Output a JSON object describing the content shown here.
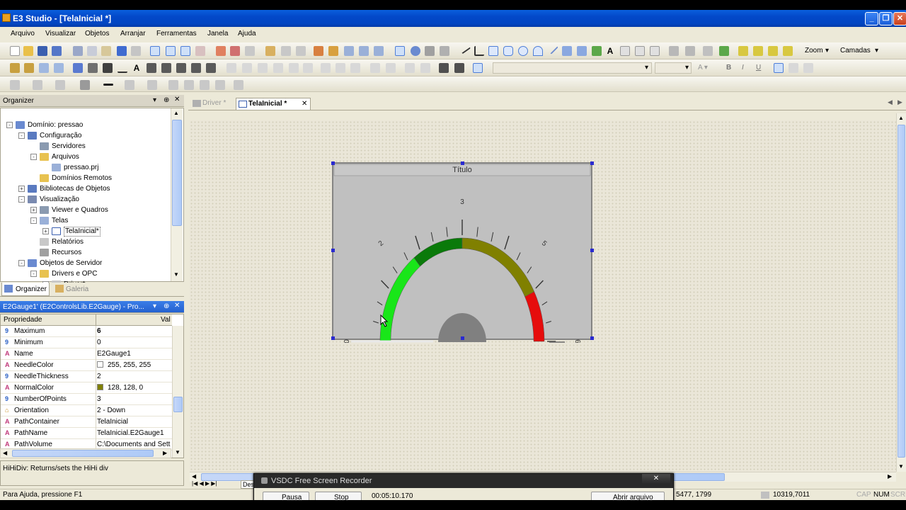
{
  "app": {
    "title": "E3 Studio - [TelaInicial *]"
  },
  "menu": [
    "Arquivo",
    "Visualizar",
    "Objetos",
    "Arranjar",
    "Ferramentas",
    "Janela",
    "Ajuda"
  ],
  "toolbar": {
    "zoom_label": "Zoom",
    "layers_label": "Camadas"
  },
  "organizer": {
    "title": "Organizer",
    "tree": [
      {
        "label": "Domínio: pressao",
        "level": 0,
        "exp": "-",
        "icon": "domain-icon"
      },
      {
        "label": "Configuração",
        "level": 1,
        "exp": "-",
        "icon": "config-icon"
      },
      {
        "label": "Servidores",
        "level": 2,
        "exp": "",
        "icon": "server-icon"
      },
      {
        "label": "Arquivos",
        "level": 2,
        "exp": "-",
        "icon": "folder-icon"
      },
      {
        "label": "pressao.prj",
        "level": 3,
        "exp": "",
        "icon": "file-icon"
      },
      {
        "label": "Domínios Remotos",
        "level": 2,
        "exp": "",
        "icon": "folder-icon"
      },
      {
        "label": "Bibliotecas de Objetos",
        "level": 1,
        "exp": "+",
        "icon": "library-icon"
      },
      {
        "label": "Visualização",
        "level": 1,
        "exp": "-",
        "icon": "visual-icon"
      },
      {
        "label": "Viewer e Quadros",
        "level": 2,
        "exp": "+",
        "icon": "viewer-icon"
      },
      {
        "label": "Telas",
        "level": 2,
        "exp": "-",
        "icon": "screens-icon"
      },
      {
        "label": "TelaInicial*",
        "level": 3,
        "exp": "+",
        "icon": "screen-icon"
      },
      {
        "label": "Relatórios",
        "level": 2,
        "exp": "",
        "icon": "report-icon"
      },
      {
        "label": "Recursos",
        "level": 2,
        "exp": "",
        "icon": "resource-icon"
      },
      {
        "label": "Objetos de Servidor",
        "level": 1,
        "exp": "-",
        "icon": "server-objects-icon"
      },
      {
        "label": "Drivers e OPC",
        "level": 2,
        "exp": "-",
        "icon": "folder-icon"
      },
      {
        "label": "Driver*",
        "level": 3,
        "exp": "+",
        "icon": "driver-icon"
      }
    ],
    "tabs": [
      "Organizer",
      "Galeria"
    ]
  },
  "properties": {
    "title": "E2Gauge1' (E2ControlsLib.E2Gauge) - Pro...",
    "col_property": "Propriedade",
    "col_value": "Val",
    "rows": [
      {
        "name": "Maximum",
        "value": "6",
        "icon": "9",
        "swatch": ""
      },
      {
        "name": "Minimum",
        "value": "0",
        "icon": "9",
        "swatch": ""
      },
      {
        "name": "Name",
        "value": "E2Gauge1",
        "icon": "A",
        "swatch": ""
      },
      {
        "name": "NeedleColor",
        "value": "255, 255, 255",
        "icon": "A",
        "swatch": "#ffffff"
      },
      {
        "name": "NeedleThickness",
        "value": "2",
        "icon": "9",
        "swatch": ""
      },
      {
        "name": "NormalColor",
        "value": "128, 128, 0",
        "icon": "A",
        "swatch": "#808000"
      },
      {
        "name": "NumberOfPoints",
        "value": "3",
        "icon": "9",
        "swatch": ""
      },
      {
        "name": "Orientation",
        "value": "2 - Down",
        "icon": "⌂",
        "swatch": ""
      },
      {
        "name": "PathContainer",
        "value": "TelaInicial",
        "icon": "A",
        "swatch": ""
      },
      {
        "name": "PathName",
        "value": "TelaInicial.E2Gauge1",
        "icon": "A",
        "swatch": ""
      },
      {
        "name": "PathVolume",
        "value": "C:\\Documents and Sett",
        "icon": "A",
        "swatch": ""
      }
    ],
    "description": "HiHiDiv: Returns/sets the HiHi div"
  },
  "doc_tabs": [
    {
      "label": "Driver *",
      "active": false
    },
    {
      "label": "TelaInicial *",
      "active": true
    }
  ],
  "gauge": {
    "title": "Título",
    "label_top": "3",
    "label_left": "2",
    "label_right": "5",
    "label_min": "0",
    "label_max": "6"
  },
  "bottom_tab": "Des",
  "recorder": {
    "title": "VSDC Free Screen Recorder",
    "btn_pause": "Pausa",
    "btn_stop": "Stop",
    "time": "00:05:10.170",
    "btn_open": "Abrir arquivo"
  },
  "status": {
    "help": "Para Ajuda, pressione F1",
    "coords": "5477, 1799",
    "size": "10319,7011",
    "cap": "CAP",
    "num": "NUM",
    "scrl": "SCRL"
  }
}
